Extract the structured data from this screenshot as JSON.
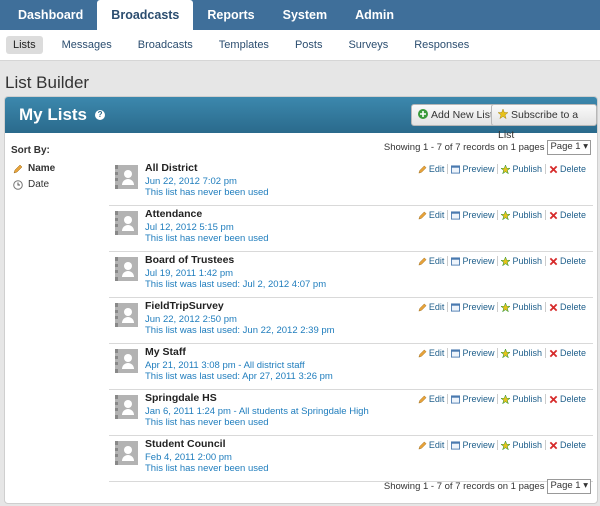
{
  "topnav": {
    "tabs": [
      "Dashboard",
      "Broadcasts",
      "Reports",
      "System",
      "Admin"
    ],
    "active": "Broadcasts"
  },
  "subnav": {
    "items": [
      "Lists",
      "Messages",
      "Broadcasts",
      "Templates",
      "Posts",
      "Surveys",
      "Responses"
    ],
    "active": "Lists"
  },
  "page_title": "List Builder",
  "panel": {
    "title": "My Lists",
    "help": "?",
    "add_button": "Add New List",
    "subscribe_button": "Subscribe to a List"
  },
  "sort": {
    "label": "Sort By:",
    "options": [
      "Name",
      "Date"
    ]
  },
  "pager": {
    "text": "Showing 1 - 7 of 7 records on 1 pages",
    "page": "Page 1"
  },
  "actions": {
    "edit": "Edit",
    "preview": "Preview",
    "publish": "Publish",
    "delete": "Delete"
  },
  "lists": [
    {
      "name": "All District",
      "date": "Jun 22, 2012 7:02 pm",
      "used": "This list has never been used"
    },
    {
      "name": "Attendance",
      "date": "Jul 12, 2012 5:15 pm",
      "used": "This list has never been used"
    },
    {
      "name": "Board of Trustees",
      "date": "Jul 19, 2011 1:42 pm",
      "used": "This list was last used: Jul 2, 2012 4:07 pm"
    },
    {
      "name": "FieldTripSurvey",
      "date": "Jun 22, 2012 2:50 pm",
      "used": "This list was last used: Jun 22, 2012 2:39 pm"
    },
    {
      "name": "My Staff",
      "date": "Apr 21, 2011 3:08 pm - All district staff",
      "used": "This list was last used: Apr 27, 2011 3:26 pm"
    },
    {
      "name": "Springdale HS",
      "date": "Jan 6, 2011 1:24 pm - All students at Springdale High",
      "used": "This list has never been used"
    },
    {
      "name": "Student Council",
      "date": "Feb 4, 2011 2:00 pm",
      "used": "This list has never been used"
    }
  ],
  "colors": {
    "topnav": "#3f6f9a",
    "panel_header": "#2a6a8c",
    "link": "#1f7dbd"
  }
}
